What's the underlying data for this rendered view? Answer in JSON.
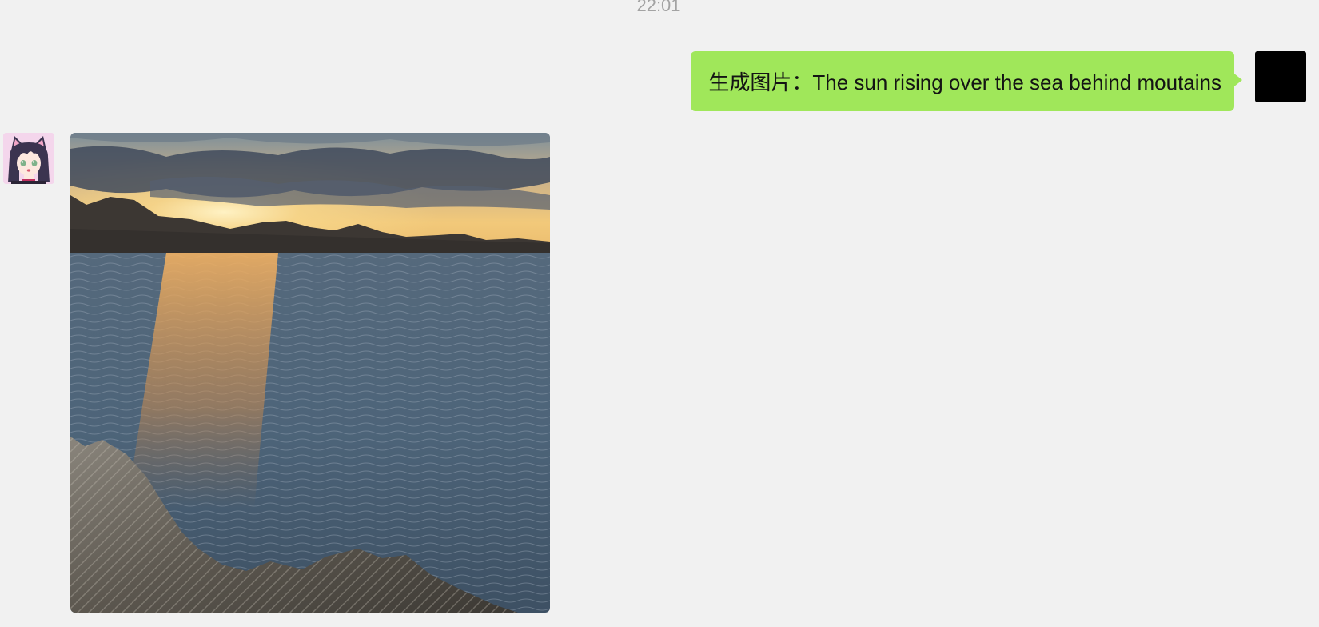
{
  "chat": {
    "timestamp": "22:01",
    "user_message": {
      "text": "生成图片：The sun rising over the sea behind moutains",
      "bubble_color": "#a0e75a"
    },
    "user_avatar": {
      "color": "#000000"
    },
    "bot_avatar": {
      "icon": "anime-cat-girl-avatar"
    },
    "bot_reply": {
      "type": "image",
      "icon": "sunrise-over-sea-photo"
    }
  },
  "colors": {
    "background": "#f1f1f1",
    "timestamp": "#a3a3a3"
  }
}
